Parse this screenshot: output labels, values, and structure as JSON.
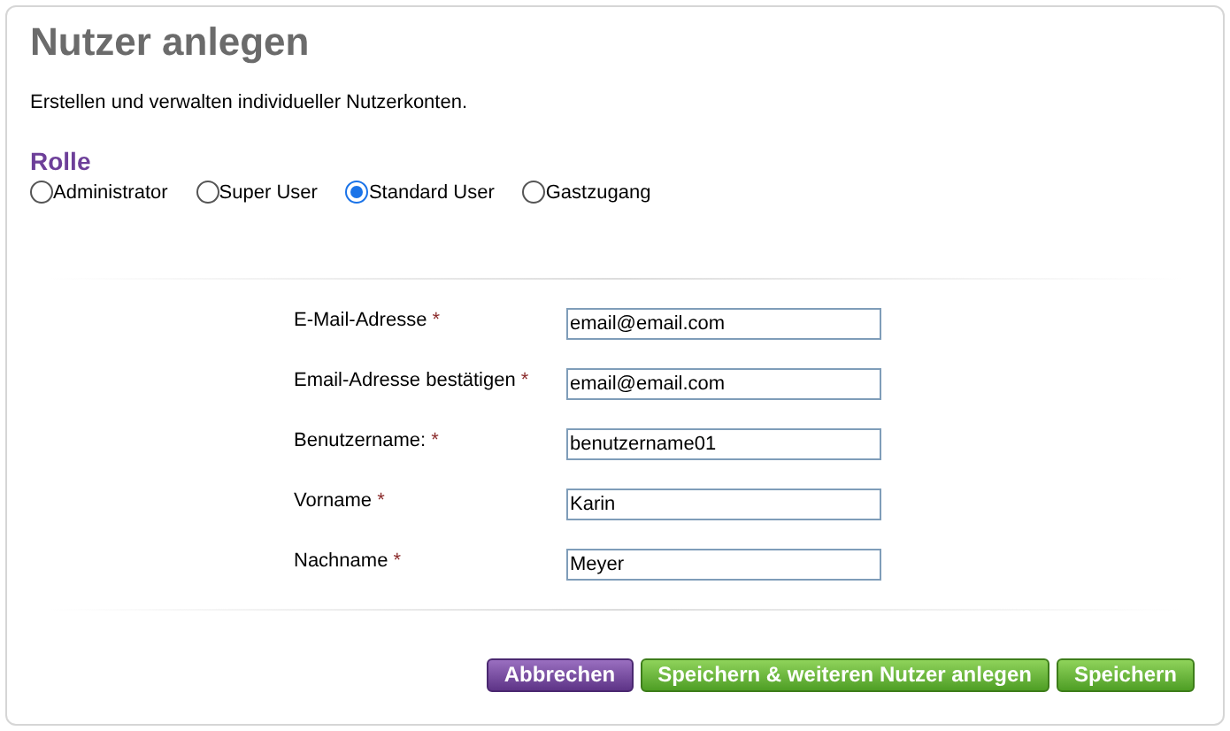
{
  "title": "Nutzer anlegen",
  "description": "Erstellen und verwalten individueller Nutzerkonten.",
  "role": {
    "heading": "Rolle",
    "options": [
      {
        "label": "Administrator",
        "selected": false
      },
      {
        "label": "Super User",
        "selected": false
      },
      {
        "label": "Standard User",
        "selected": true
      },
      {
        "label": "Gastzugang",
        "selected": false
      }
    ]
  },
  "fields": [
    {
      "label": "E-Mail-Adresse",
      "required_mark": "*",
      "value": "email@email.com"
    },
    {
      "label": "Email-Adresse bestätigen",
      "required_mark": "*",
      "value": "email@email.com"
    },
    {
      "label": "Benutzername:",
      "required_mark": "*",
      "value": "benutzername01"
    },
    {
      "label": "Vorname",
      "required_mark": "*",
      "value": "Karin"
    },
    {
      "label": "Nachname",
      "required_mark": "*",
      "value": "Meyer"
    }
  ],
  "buttons": [
    {
      "label": "Abbrechen",
      "kind": "cancel"
    },
    {
      "label": "Speichern & weiteren Nutzer anlegen",
      "kind": "save"
    },
    {
      "label": "Speichern",
      "kind": "save"
    }
  ]
}
